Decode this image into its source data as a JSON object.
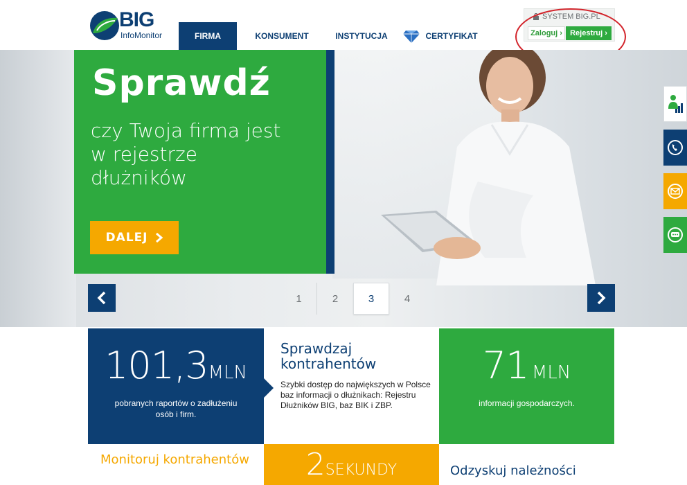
{
  "header": {
    "logo": {
      "brand": "BIG",
      "sub": "InfoMonitor"
    },
    "nav": [
      {
        "label": "FIRMA",
        "active": true
      },
      {
        "label": "KONSUMENT"
      },
      {
        "label": "INSTYTUCJA"
      },
      {
        "label": "CERTYFIKAT",
        "icon": "diamond-icon"
      }
    ],
    "system": {
      "label": "SYSTEM BIG.PL",
      "login_label": "Zaloguj",
      "register_label": "Rejestruj"
    }
  },
  "hero": {
    "title": "Sprawdź",
    "text": "czy Twoja firma jest w rejestrze dłużników",
    "button_label": "DALEJ",
    "colors": {
      "panel": "#2eaa3f",
      "button": "#f5a800",
      "strip": "#0d3f73"
    }
  },
  "side_tabs": [
    "person-chart-icon",
    "phone-icon",
    "mail-icon",
    "chat-icon"
  ],
  "slider": {
    "pages": [
      "1",
      "2",
      "3",
      "4"
    ],
    "active_page": "3"
  },
  "tiles": {
    "reports": {
      "number": "101,3",
      "unit": "MLN",
      "caption": "pobranych raportów o zadłużeniu osób i firm."
    },
    "check": {
      "title": "Sprawdzaj kontrahentów",
      "text": "Szybki dostęp do największych w Polsce baz informacji o dłużnikach: Rejestru Dłużników BIG, baz BIK i ZBP."
    },
    "info": {
      "number": "71",
      "unit": "MLN",
      "caption": "informacji gospodarczych."
    },
    "monitor": {
      "title": "Monitoruj kontrahentów"
    },
    "seconds": {
      "number": "2",
      "unit": "SEKUNDY"
    },
    "recover": {
      "title": "Odzyskuj należności"
    }
  },
  "colors": {
    "navy": "#0d3f73",
    "green": "#2eaa3f",
    "orange": "#f5a800",
    "highlight": "#d2232a"
  }
}
